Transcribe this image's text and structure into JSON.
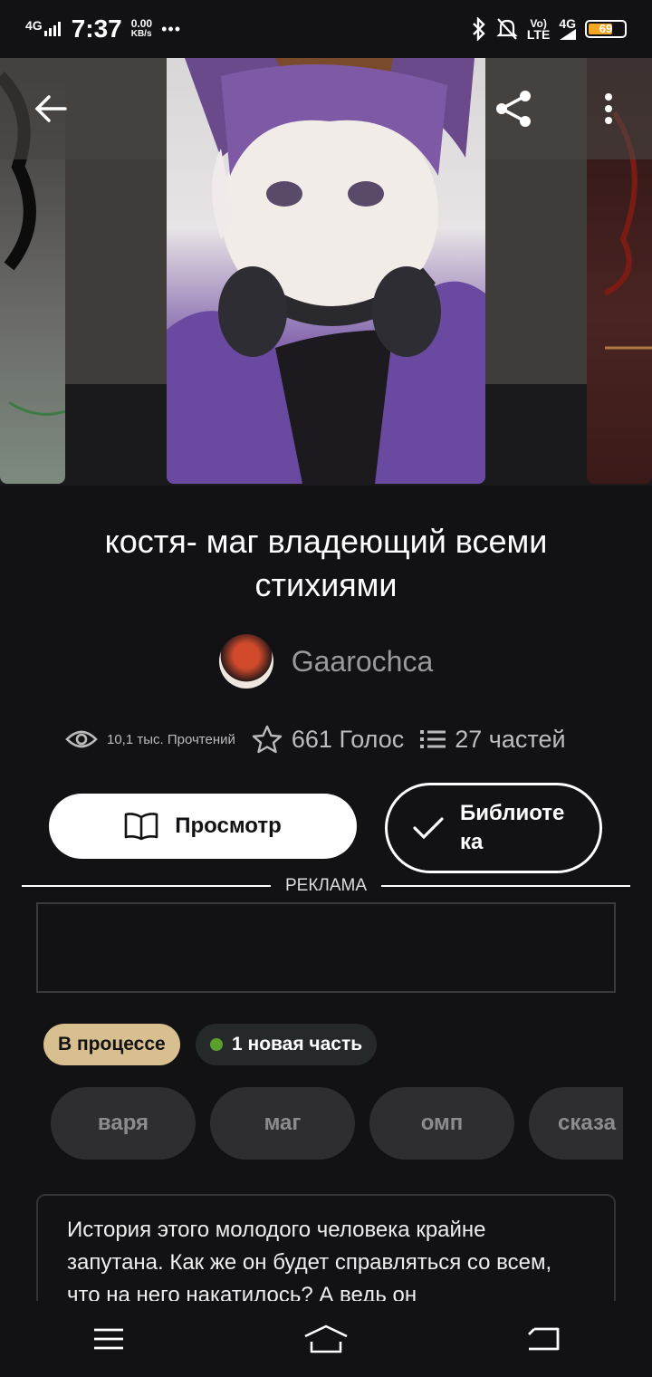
{
  "status_bar": {
    "network_left": "4G",
    "time": "7:37",
    "speed_value": "0.00",
    "speed_unit": "KB/s",
    "more": "•••",
    "volte": "Vo)",
    "lte": "LTE",
    "network_right": "4G",
    "battery": "69",
    "battery_level": 0.69,
    "battery_color": "#f5a623"
  },
  "toolbar": {
    "back_icon": "arrow-left-icon",
    "share_icon": "share-icon",
    "more_icon": "vertical-dots-icon"
  },
  "story": {
    "title": "костя- маг владеющий всеми стихиями",
    "author": "Gaarochca",
    "reads": "10,1 тыс. Прочтений",
    "votes": "661 Голос",
    "parts": "27 частей"
  },
  "actions": {
    "read_label": "Просмотр",
    "library_label": "Библиоте ка"
  },
  "ad": {
    "label": "РЕКЛАМА"
  },
  "status_chips": {
    "status": "В процессе",
    "new_part": "1 новая часть",
    "status_color": "#d8bf8f",
    "new_dot_color": "#5aa02c"
  },
  "tags": [
    {
      "label": "варя"
    },
    {
      "label": "маг"
    },
    {
      "label": "омп"
    },
    {
      "label": "сказа"
    }
  ],
  "description": "История этого молодого человека крайне запутана. Как же он будет справляться со всем, что на него накатилось? А ведь он",
  "navbar": {
    "menu_icon": "menu-icon",
    "home_icon": "home-icon",
    "back_icon": "back-icon"
  }
}
